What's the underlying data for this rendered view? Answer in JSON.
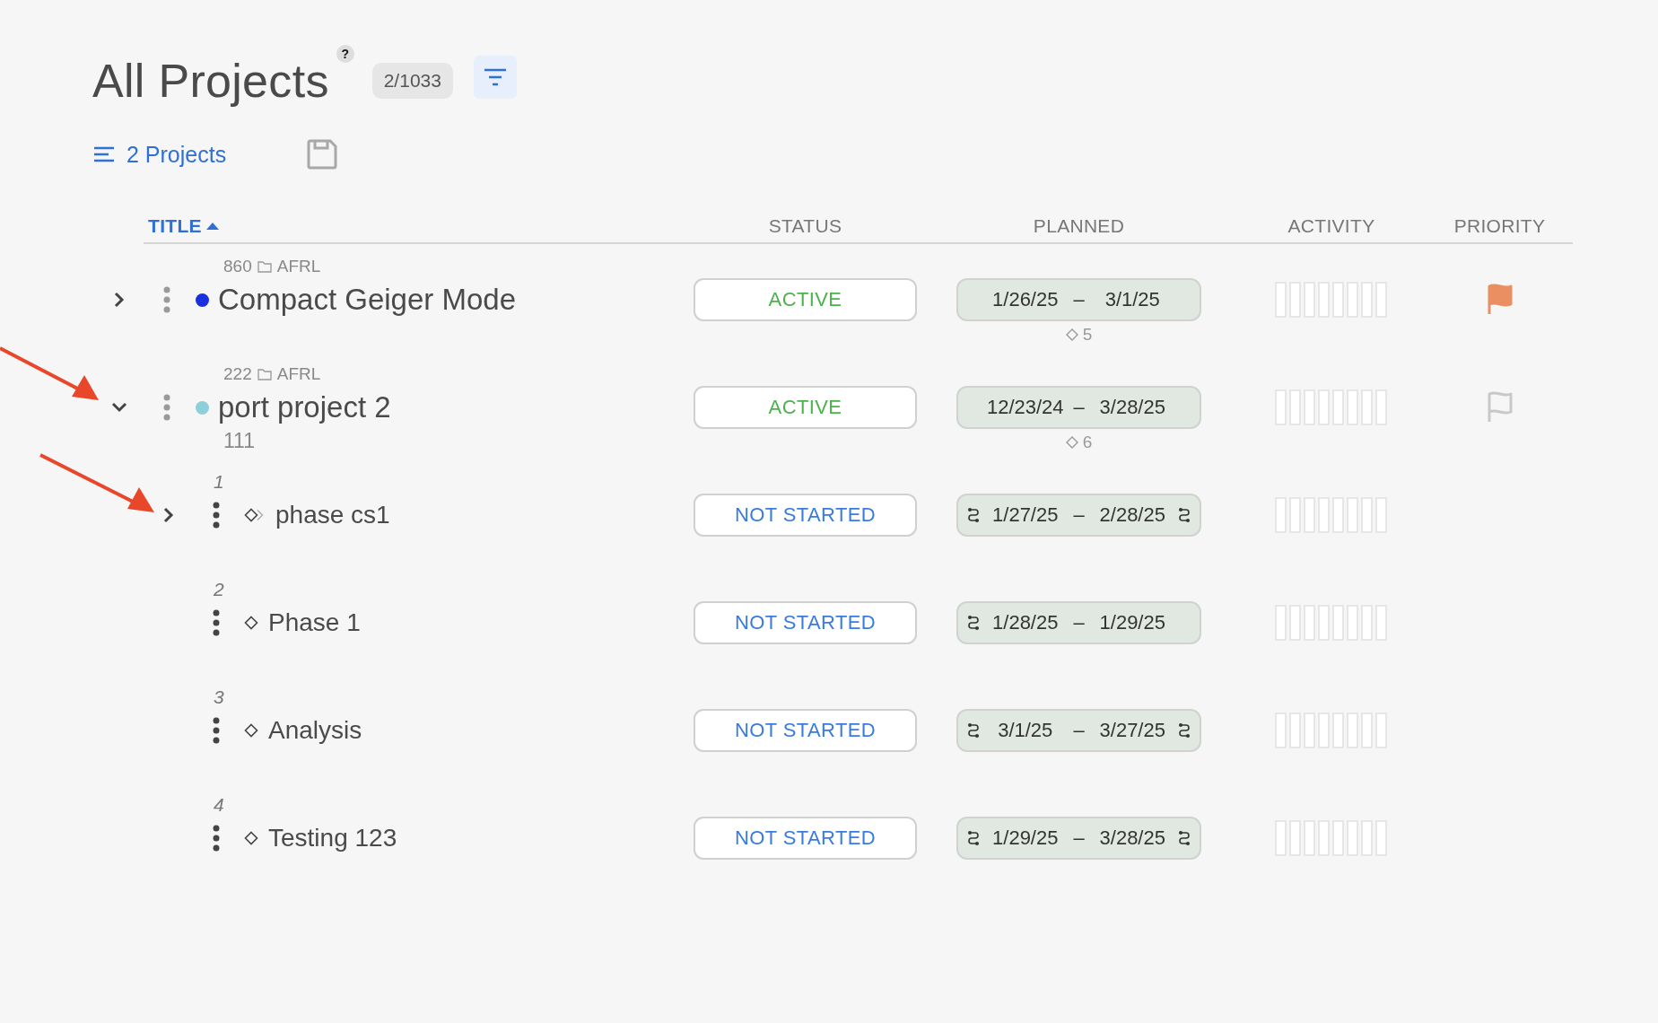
{
  "header": {
    "title": "All Projects",
    "help": "?",
    "count": "2/1033"
  },
  "toolbar": {
    "list_label": "2 Projects"
  },
  "table": {
    "columns": [
      {
        "label": "TITLE",
        "sorted": true
      },
      {
        "label": "STATUS",
        "sorted": false
      },
      {
        "label": "PLANNED",
        "sorted": false
      },
      {
        "label": "ACTIVITY",
        "sorted": false
      },
      {
        "label": "PRIORITY",
        "sorted": false
      }
    ],
    "rows": [
      {
        "kind": "project",
        "number": "860",
        "folder": "AFRL",
        "title": "Compact Geiger Mode",
        "color": "#1a2fe0",
        "expanded": false,
        "status": {
          "kind": "active",
          "label": "ACTIVE"
        },
        "planned": {
          "start": "1/26/25",
          "dash": "–",
          "end": "3/1/25",
          "start_linked": false,
          "end_linked": false
        },
        "milestones": "5",
        "flagged": true
      },
      {
        "kind": "project",
        "number": "222",
        "folder": "AFRL",
        "title": "port project 2",
        "subtitle": "111",
        "color": "#8ecfdc",
        "expanded": true,
        "status": {
          "kind": "active",
          "label": "ACTIVE"
        },
        "planned": {
          "start": "12/23/24",
          "dash": "–",
          "end": "3/28/25",
          "start_linked": false,
          "end_linked": false
        },
        "milestones": "6",
        "flagged": false,
        "children": [
          {
            "kind": "phase_group",
            "number": "1",
            "title": "phase cs1",
            "expanded": false,
            "status": {
              "kind": "not_started",
              "label": "NOT STARTED"
            },
            "planned": {
              "start": "1/27/25",
              "dash": "–",
              "end": "2/28/25",
              "start_linked": true,
              "end_linked": true
            }
          },
          {
            "kind": "phase",
            "number": "2",
            "title": "Phase 1",
            "status": {
              "kind": "not_started",
              "label": "NOT STARTED"
            },
            "planned": {
              "start": "1/28/25",
              "dash": "–",
              "end": "1/29/25",
              "start_linked": true,
              "end_linked": false
            }
          },
          {
            "kind": "phase",
            "number": "3",
            "title": "Analysis",
            "status": {
              "kind": "not_started",
              "label": "NOT STARTED"
            },
            "planned": {
              "start": "3/1/25",
              "dash": "–",
              "end": "3/27/25",
              "start_linked": true,
              "end_linked": true
            }
          },
          {
            "kind": "phase",
            "number": "4",
            "title": "Testing 123",
            "status": {
              "kind": "not_started",
              "label": "NOT STARTED"
            },
            "planned": {
              "start": "1/29/25",
              "dash": "–",
              "end": "3/28/25",
              "start_linked": true,
              "end_linked": true
            }
          }
        ]
      }
    ]
  }
}
